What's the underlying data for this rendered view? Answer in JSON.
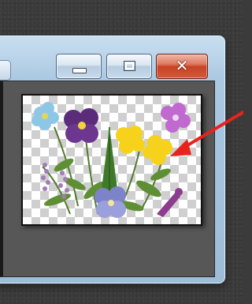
{
  "window": {
    "buttons": {
      "minimize_icon": "minimize-icon",
      "maximize_icon": "maximize-icon",
      "close_glyph": "✕"
    }
  },
  "thumbnail": {
    "content": "pressed-flowers-image",
    "background": "transparency-checkerboard"
  },
  "annotation": {
    "type": "arrow",
    "color": "#e8231c"
  },
  "colors": {
    "close_button": "#c84325",
    "window_frame": "#aac8e2",
    "content_bg": "#575757"
  }
}
